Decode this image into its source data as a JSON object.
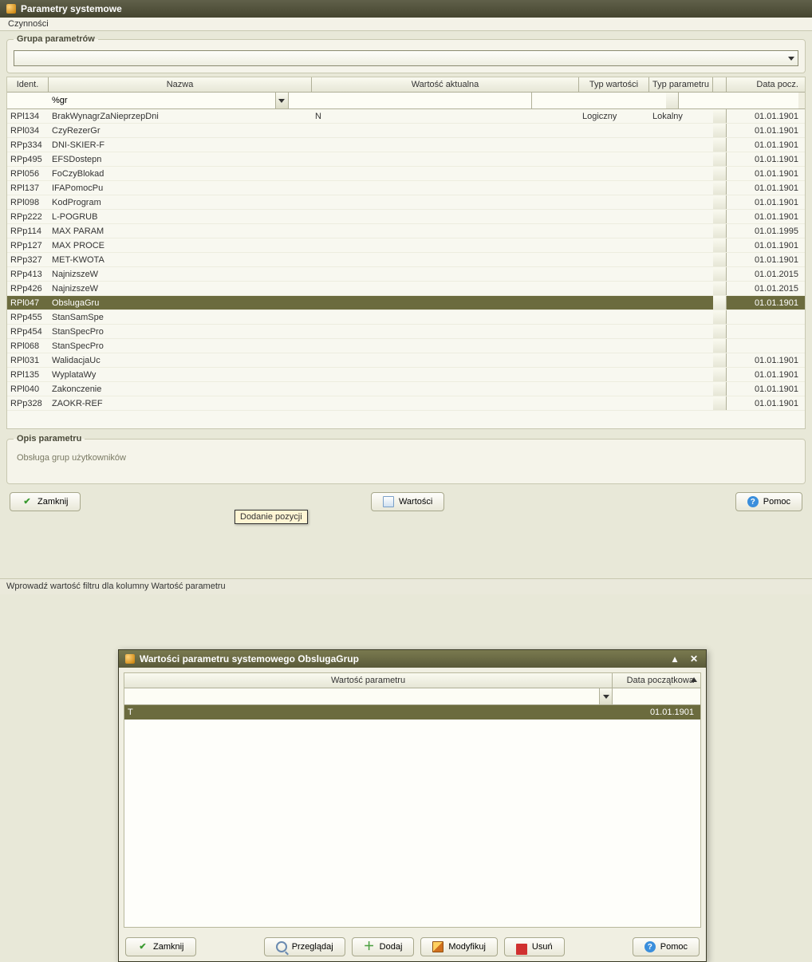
{
  "window": {
    "title": "Parametry systemowe"
  },
  "menu": {
    "czynnosci": "Czynności"
  },
  "group_params": {
    "legend": "Grupa parametrów",
    "value": ""
  },
  "grid": {
    "headers": {
      "ident": "Ident.",
      "nazwa": "Nazwa",
      "wartosc": "Wartość aktualna",
      "typ_w": "Typ wartości",
      "typ_p": "Typ parametru",
      "data": "Data pocz."
    },
    "filter": {
      "ident": "",
      "nazwa": "%gr",
      "wartosc": "",
      "typ_w": "",
      "typ_p": "",
      "data": ""
    },
    "rows": [
      {
        "ident": "RPl134",
        "nazwa": "BrakWynagrZaNieprzepDni",
        "wartosc": "N",
        "typ_w": "Logiczny",
        "typ_p": "Lokalny",
        "data": "01.01.1901",
        "sel": false
      },
      {
        "ident": "RPl034",
        "nazwa": "CzyRezerGr",
        "wartosc": "",
        "typ_w": "",
        "typ_p": "",
        "data": "01.01.1901",
        "sel": false
      },
      {
        "ident": "RPp334",
        "nazwa": "DNI-SKIER-F",
        "wartosc": "",
        "typ_w": "",
        "typ_p": "",
        "data": "01.01.1901",
        "sel": false
      },
      {
        "ident": "RPp495",
        "nazwa": "EFSDostepn",
        "wartosc": "",
        "typ_w": "",
        "typ_p": "",
        "data": "01.01.1901",
        "sel": false
      },
      {
        "ident": "RPl056",
        "nazwa": "FoCzyBlokad",
        "wartosc": "",
        "typ_w": "",
        "typ_p": "",
        "data": "01.01.1901",
        "sel": false
      },
      {
        "ident": "RPl137",
        "nazwa": "IFAPomocPu",
        "wartosc": "",
        "typ_w": "",
        "typ_p": "",
        "data": "01.01.1901",
        "sel": false
      },
      {
        "ident": "RPl098",
        "nazwa": "KodProgram",
        "wartosc": "",
        "typ_w": "",
        "typ_p": "",
        "data": "01.01.1901",
        "sel": false
      },
      {
        "ident": "RPp222",
        "nazwa": "L-POGRUB",
        "wartosc": "",
        "typ_w": "",
        "typ_p": "",
        "data": "01.01.1901",
        "sel": false
      },
      {
        "ident": "RPp114",
        "nazwa": "MAX PARAM",
        "wartosc": "",
        "typ_w": "",
        "typ_p": "",
        "data": "01.01.1995",
        "sel": false
      },
      {
        "ident": "RPp127",
        "nazwa": "MAX PROCE",
        "wartosc": "",
        "typ_w": "",
        "typ_p": "",
        "data": "01.01.1901",
        "sel": false
      },
      {
        "ident": "RPp327",
        "nazwa": "MET-KWOTA",
        "wartosc": "",
        "typ_w": "",
        "typ_p": "",
        "data": "01.01.1901",
        "sel": false
      },
      {
        "ident": "RPp413",
        "nazwa": "NajnizszeW",
        "wartosc": "",
        "typ_w": "",
        "typ_p": "",
        "data": "01.01.2015",
        "sel": false
      },
      {
        "ident": "RPp426",
        "nazwa": "NajnizszeW",
        "wartosc": "",
        "typ_w": "",
        "typ_p": "",
        "data": "01.01.2015",
        "sel": false
      },
      {
        "ident": "RPl047",
        "nazwa": "ObslugaGru",
        "wartosc": "",
        "typ_w": "",
        "typ_p": "",
        "data": "01.01.1901",
        "sel": true
      },
      {
        "ident": "RPp455",
        "nazwa": "StanSamSpe",
        "wartosc": "",
        "typ_w": "",
        "typ_p": "",
        "data": "",
        "sel": false
      },
      {
        "ident": "RPp454",
        "nazwa": "StanSpecPro",
        "wartosc": "",
        "typ_w": "",
        "typ_p": "",
        "data": "",
        "sel": false
      },
      {
        "ident": "RPl068",
        "nazwa": "StanSpecPro",
        "wartosc": "",
        "typ_w": "",
        "typ_p": "",
        "data": "",
        "sel": false
      },
      {
        "ident": "RPl031",
        "nazwa": "WalidacjaUc",
        "wartosc": "",
        "typ_w": "",
        "typ_p": "",
        "data": "01.01.1901",
        "sel": false
      },
      {
        "ident": "RPl135",
        "nazwa": "WyplataWy",
        "wartosc": "",
        "typ_w": "",
        "typ_p": "",
        "data": "01.01.1901",
        "sel": false
      },
      {
        "ident": "RPl040",
        "nazwa": "Zakonczenie",
        "wartosc": "",
        "typ_w": "",
        "typ_p": "",
        "data": "01.01.1901",
        "sel": false
      },
      {
        "ident": "RPp328",
        "nazwa": "ZAOKR-REF",
        "wartosc": "",
        "typ_w": "",
        "typ_p": "",
        "data": "01.01.1901",
        "sel": false
      }
    ]
  },
  "desc": {
    "legend": "Opis parametru",
    "text": "Obsługa grup użytkowników"
  },
  "buttons": {
    "zamknij": "Zamknij",
    "wartosci": "Wartości",
    "pomoc": "Pomoc",
    "przegladaj": "Przeglądaj",
    "dodaj": "Dodaj",
    "modyfikuj": "Modyfikuj",
    "usun": "Usuń"
  },
  "modal": {
    "title": "Wartości parametru systemowego ObslugaGrup",
    "headers": {
      "wartosc": "Wartość parametru",
      "data": "Data początkowa"
    },
    "rows": [
      {
        "wartosc": "T",
        "data": "01.01.1901",
        "sel": true
      }
    ],
    "tooltip": "Dodanie pozycji"
  },
  "status": {
    "text": "Wprowadź wartość filtru dla kolumny Wartość parametru"
  }
}
